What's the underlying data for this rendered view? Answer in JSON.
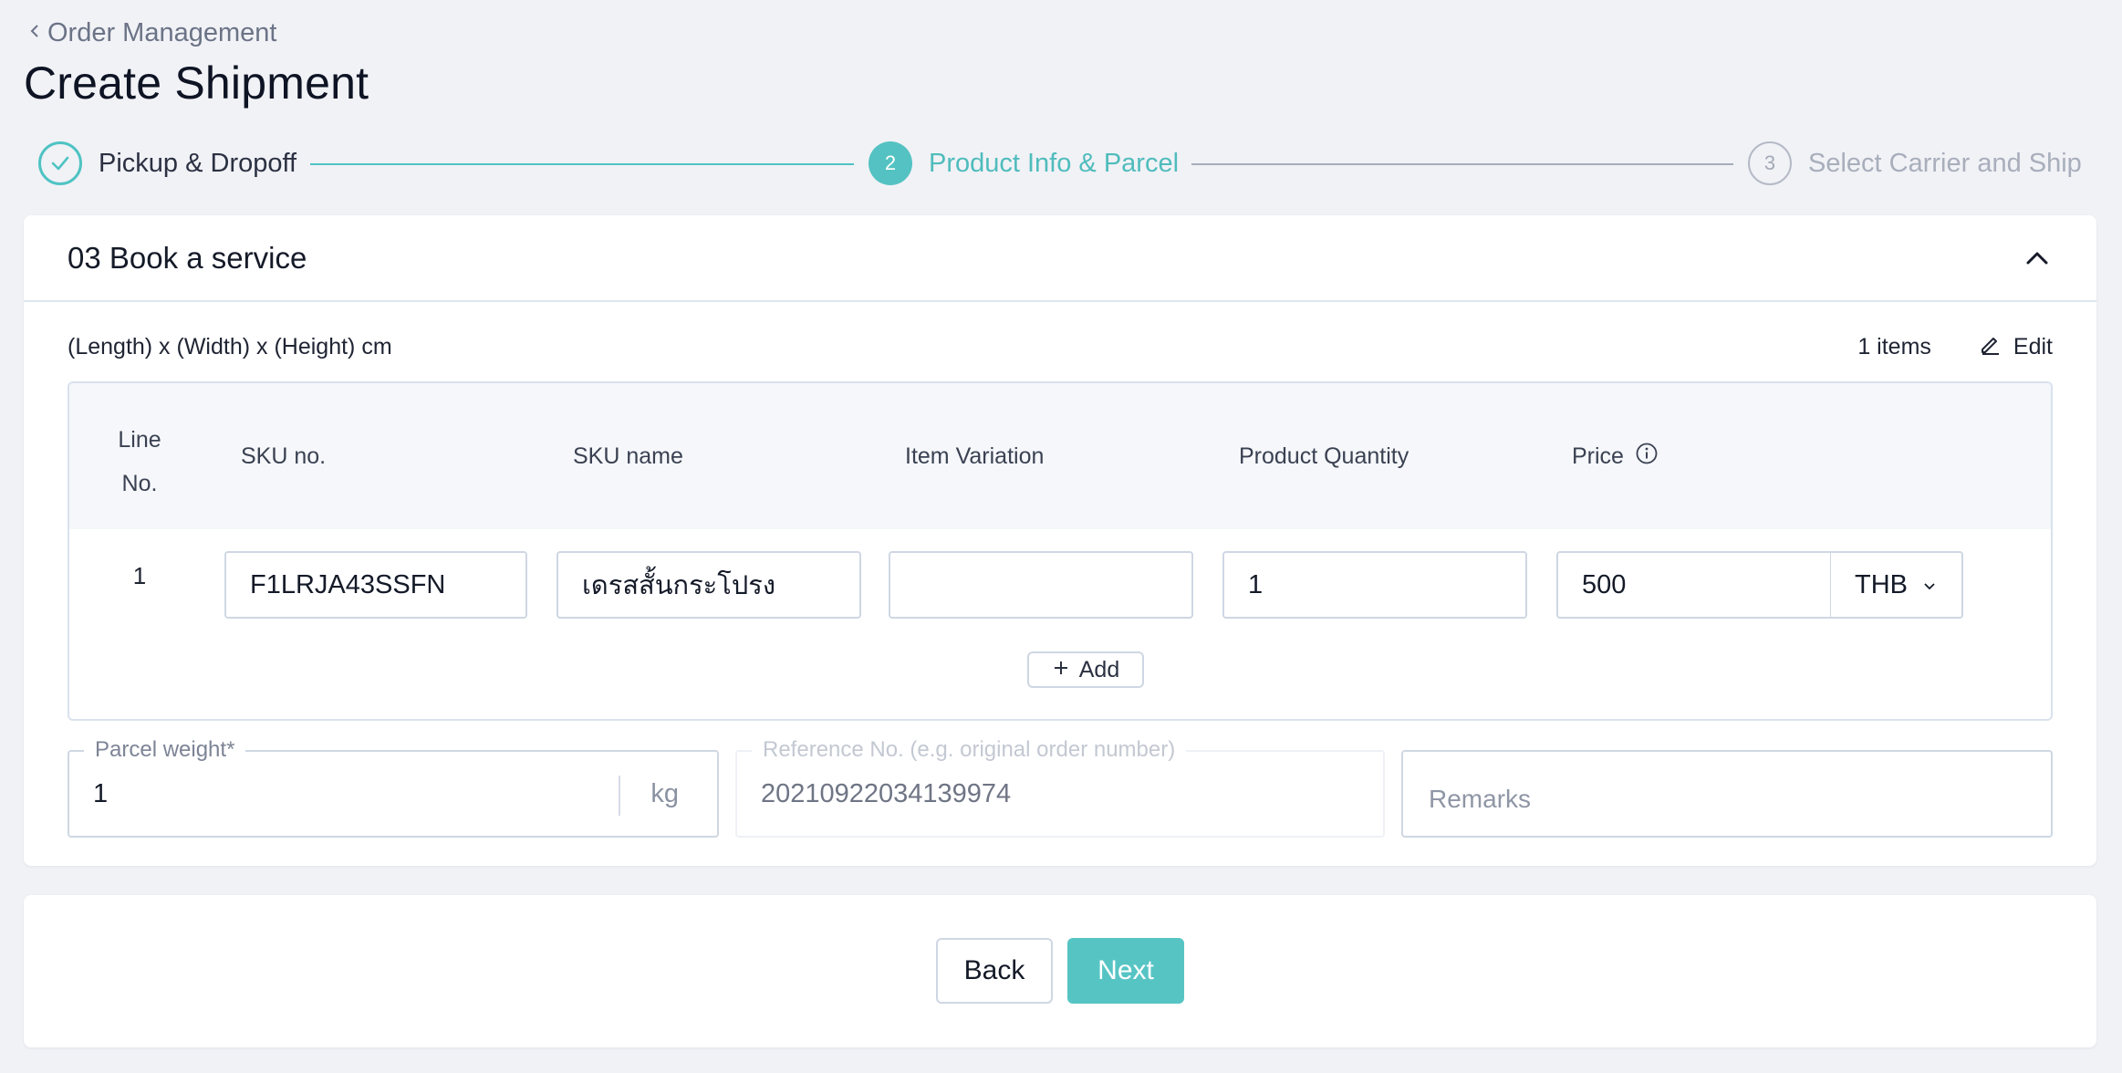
{
  "breadcrumb": {
    "label": "Order Management"
  },
  "page": {
    "title": "Create Shipment"
  },
  "stepper": {
    "steps": [
      {
        "number": "1",
        "label": "Pickup & Dropoff",
        "status": "done"
      },
      {
        "number": "2",
        "label": "Product Info & Parcel",
        "status": "active"
      },
      {
        "number": "3",
        "label": "Select Carrier and Ship",
        "status": "todo"
      }
    ]
  },
  "section": {
    "title": "03 Book a service",
    "dimensions_label": "(Length) x (Width) x (Height) cm",
    "items_count": "1 items",
    "edit_label": "Edit"
  },
  "table": {
    "columns": {
      "line_no_1": "Line",
      "line_no_2": "No.",
      "sku_no": "SKU no.",
      "sku_name": "SKU name",
      "item_variation": "Item Variation",
      "product_quantity": "Product Quantity",
      "price": "Price"
    },
    "rows": [
      {
        "line_no": "1",
        "sku_no": "F1LRJA43SSFN",
        "sku_name": "เดรสสั้นกระโปรง",
        "item_variation": "",
        "quantity": "1",
        "price": "500",
        "currency": "THB"
      }
    ],
    "add_label": "Add"
  },
  "parcel": {
    "weight_label": "Parcel weight",
    "weight_required_mark": "*",
    "weight_value": "1",
    "weight_unit": "kg",
    "reference_label": "Reference No. (e.g. original order number)",
    "reference_value": "20210922034139974",
    "remarks_placeholder": "Remarks"
  },
  "footer": {
    "back_label": "Back",
    "next_label": "Next"
  },
  "colors": {
    "accent": "#54c2c2",
    "background": "#f1f2f6",
    "text_primary": "#0e1424",
    "muted": "#a8aebb"
  }
}
